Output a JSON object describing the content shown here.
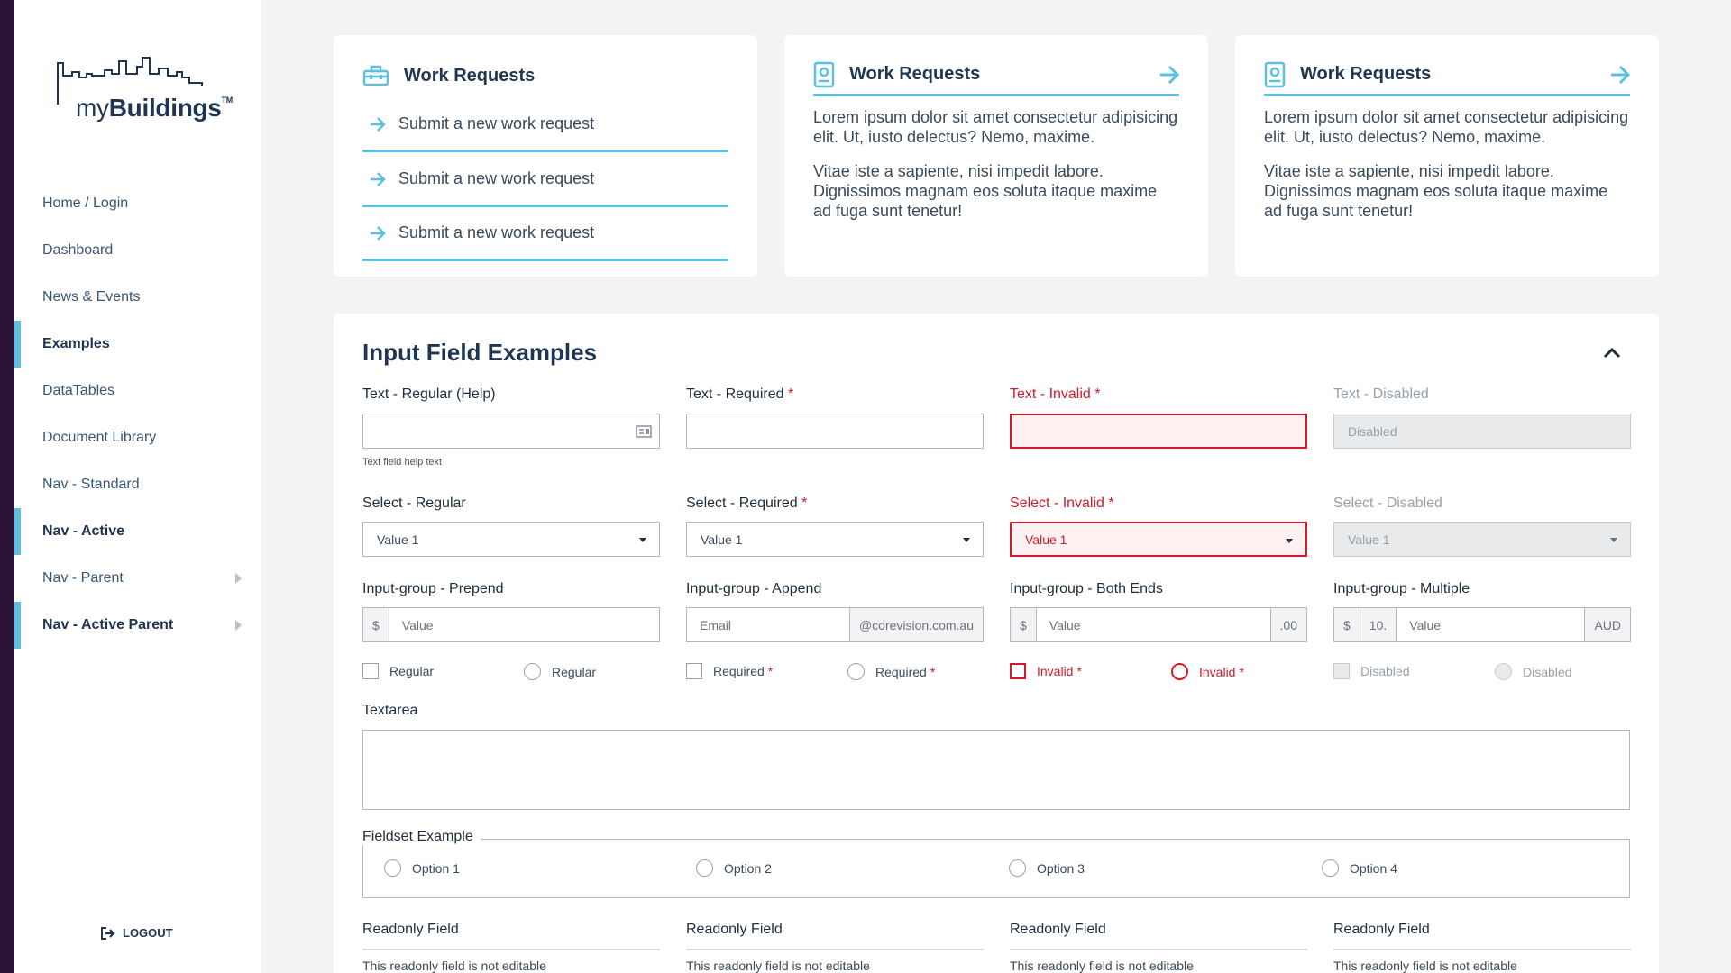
{
  "logo": {
    "prefix": "my",
    "bold": "Buildings",
    "tm": "TM"
  },
  "nav": [
    {
      "label": "Home / Login",
      "active": false,
      "parent": false
    },
    {
      "label": "Dashboard",
      "active": false,
      "parent": false
    },
    {
      "label": "News & Events",
      "active": false,
      "parent": false
    },
    {
      "label": "Examples",
      "active": true,
      "parent": false
    },
    {
      "label": "DataTables",
      "active": false,
      "parent": false
    },
    {
      "label": "Document Library",
      "active": false,
      "parent": false
    },
    {
      "label": "Nav - Standard",
      "active": false,
      "parent": false
    },
    {
      "label": "Nav - Active",
      "active": true,
      "parent": false
    },
    {
      "label": "Nav - Parent",
      "active": false,
      "parent": true
    },
    {
      "label": "Nav - Active Parent",
      "active": true,
      "parent": true
    }
  ],
  "logout": "LOGOUT",
  "cards": [
    {
      "title": "Work Requests",
      "links": [
        "Submit a new work request",
        "Submit a new work request",
        "Submit a new work request"
      ]
    },
    {
      "title": "Work Requests",
      "paragraphs": [
        "Lorem ipsum dolor sit amet consectetur adipisicing elit. Ut, iusto delectus? Nemo, maxime.",
        "Vitae iste a sapiente, nisi impedit labore. Dignissimos magnam eos soluta itaque maxime ad fuga sunt tenetur!"
      ]
    },
    {
      "title": "Work Requests",
      "paragraphs": [
        "Lorem ipsum dolor sit amet consectetur adipisicing elit. Ut, iusto delectus? Nemo, maxime.",
        "Vitae iste a sapiente, nisi impedit labore. Dignissimos magnam eos soluta itaque maxime ad fuga sunt tenetur!"
      ]
    }
  ],
  "panel": {
    "title": "Input Field Examples",
    "text": {
      "regular_label": "Text - Regular (Help)",
      "help_text": "Text field help text",
      "required_label": "Text - Required",
      "invalid_label": "Text - Invalid",
      "disabled_label": "Text - Disabled",
      "disabled_value": "Disabled",
      "star": "*"
    },
    "select": {
      "regular_label": "Select - Regular",
      "required_label": "Select - Required",
      "invalid_label": "Select - Invalid",
      "disabled_label": "Select - Disabled",
      "value": "Value 1"
    },
    "groups": {
      "prepend_label": "Input-group - Prepend",
      "append_label": "Input-group - Append",
      "both_label": "Input-group - Both Ends",
      "multiple_label": "Input-group - Multiple",
      "dollar": "$",
      "value_ph": "Value",
      "email_ph": "Email",
      "domain": "@corevision.com.au",
      "cents": ".00",
      "ten": "10.",
      "aud": "AUD"
    },
    "checks": {
      "regular": "Regular",
      "required": "Required",
      "invalid": "Invalid",
      "disabled": "Disabled"
    },
    "textarea_label": "Textarea",
    "fieldset": {
      "legend": "Fieldset Example",
      "options": [
        "Option 1",
        "Option 2",
        "Option 3",
        "Option 4"
      ]
    },
    "readonly": {
      "label": "Readonly Field",
      "value": "This readonly field is not editable"
    }
  },
  "colors": {
    "accent": "#5cc0e0",
    "invalid": "#d11a2a",
    "navy": "#1f3551"
  }
}
